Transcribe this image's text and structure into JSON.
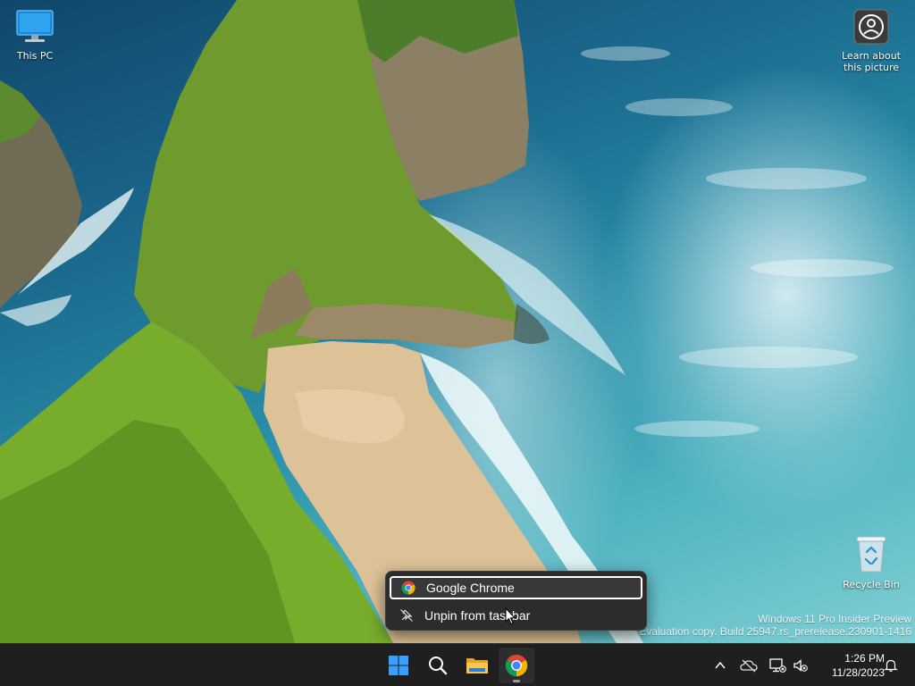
{
  "desktop": {
    "icons": [
      {
        "name": "this-pc",
        "label": "This PC",
        "icon": "monitor-icon"
      },
      {
        "name": "learn-about-picture",
        "label_line1": "Learn about",
        "label_line2": "this picture",
        "icon": "camera-info-icon"
      },
      {
        "name": "recycle-bin",
        "label": "Recycle Bin",
        "icon": "recycle-bin-icon"
      }
    ],
    "watermark": {
      "line1": "Windows 11 Pro Insider Preview",
      "line2": "Evaluation copy. Build 25947.rs_prerelease.230901-1416"
    }
  },
  "context_menu": {
    "items": [
      {
        "label": "Google Chrome",
        "icon": "chrome-icon",
        "focused": true
      },
      {
        "label": "Unpin from taskbar",
        "icon": "unpin-icon",
        "focused": false
      }
    ]
  },
  "taskbar": {
    "apps": [
      {
        "name": "start",
        "icon": "windows-logo-icon"
      },
      {
        "name": "search",
        "icon": "search-icon"
      },
      {
        "name": "file-explorer",
        "icon": "folder-icon"
      },
      {
        "name": "chrome",
        "icon": "chrome-icon",
        "active": true
      }
    ],
    "tray": {
      "icons": [
        "chevron-up-icon",
        "onedrive-offline-icon",
        "network-disconnected-icon",
        "volume-muted-icon",
        "notification-bell-icon"
      ],
      "time": "1:26 PM",
      "date": "11/28/2023"
    }
  },
  "colors": {
    "taskbar_bg": "#1f1f1f",
    "menu_bg": "#2c2c2c",
    "windows_blue": "#3aa0ff",
    "chrome_red": "#db4437",
    "chrome_yellow": "#f4b400",
    "chrome_green": "#0f9d58",
    "chrome_blue": "#4285f4"
  }
}
